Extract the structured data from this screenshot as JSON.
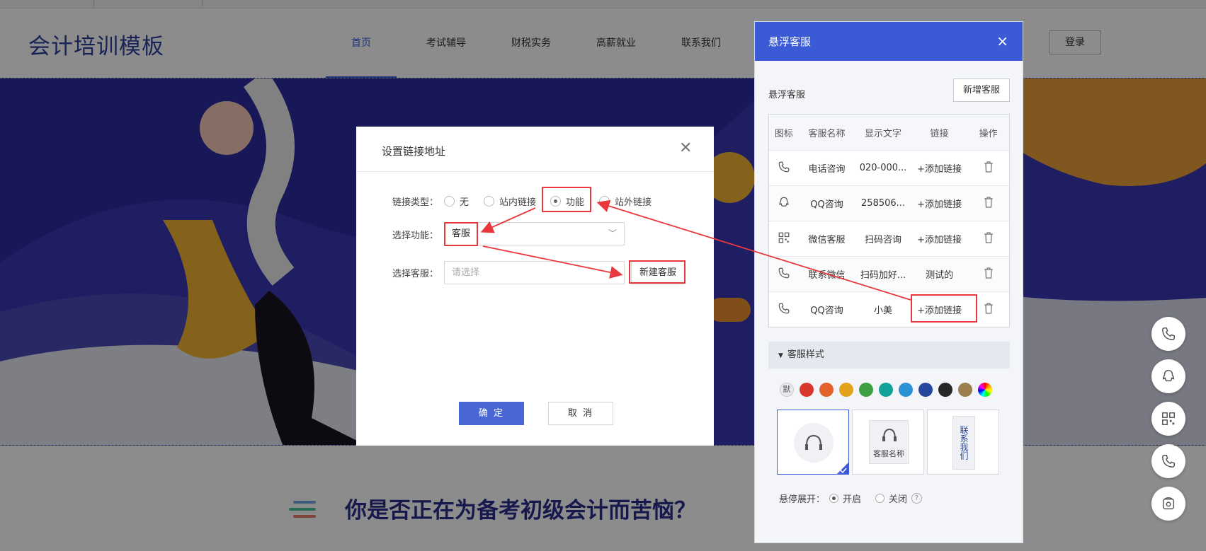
{
  "site": {
    "logo": "会计培训模板",
    "nav": [
      {
        "label": "首页",
        "active": true
      },
      {
        "label": "考试辅导"
      },
      {
        "label": "财税实务"
      },
      {
        "label": "高薪就业"
      },
      {
        "label": "联系我们"
      }
    ],
    "login": "登录",
    "below_title": "你是否正在为备考初级会计而苦恼？"
  },
  "panel": {
    "title": "悬浮客服",
    "subtitle": "悬浮客服",
    "new_button": "新增客服",
    "columns": [
      "图标",
      "客服名称",
      "显示文字",
      "链接",
      "操作"
    ],
    "rows": [
      {
        "icon": "phone-icon",
        "name": "电话咨询",
        "text": "020-000...",
        "link": "+添加链接"
      },
      {
        "icon": "qq-icon",
        "name": "QQ咨询",
        "text": "258506...",
        "link": "+添加链接"
      },
      {
        "icon": "qrcode-icon",
        "name": "微信客服",
        "text": "扫码咨询",
        "link": "+添加链接"
      },
      {
        "icon": "phone-icon",
        "name": "联系微信",
        "text": "扫码加好...",
        "link": "测试的"
      },
      {
        "icon": "phone-icon",
        "name": "QQ咨询",
        "text": "小美",
        "link": "+添加链接"
      }
    ],
    "style_section": "客服样式",
    "default_swatch": "默",
    "colors": [
      "#d9362b",
      "#e4622b",
      "#e0a31b",
      "#3fa043",
      "#11a39a",
      "#2a93d5",
      "#24469c",
      "#272727",
      "#9c7f4e"
    ],
    "card2_label": "客服名称",
    "card3_label": "联系我们",
    "hover_label": "悬停展开：",
    "hover_on": "开启",
    "hover_off": "关闭",
    "help": "?"
  },
  "modal": {
    "title": "设置链接地址",
    "link_type_label": "链接类型：",
    "link_types": [
      "无",
      "站内链接",
      "功能",
      "站外链接"
    ],
    "link_type_selected": "功能",
    "function_label": "选择功能：",
    "function_value": "客服",
    "service_label": "选择客服：",
    "service_placeholder": "请选择",
    "new_service_button": "新建客服",
    "ok": "确 定",
    "cancel": "取 消"
  },
  "colors": {
    "accent": "#3b5bd6",
    "highlight": "#e8383d"
  }
}
